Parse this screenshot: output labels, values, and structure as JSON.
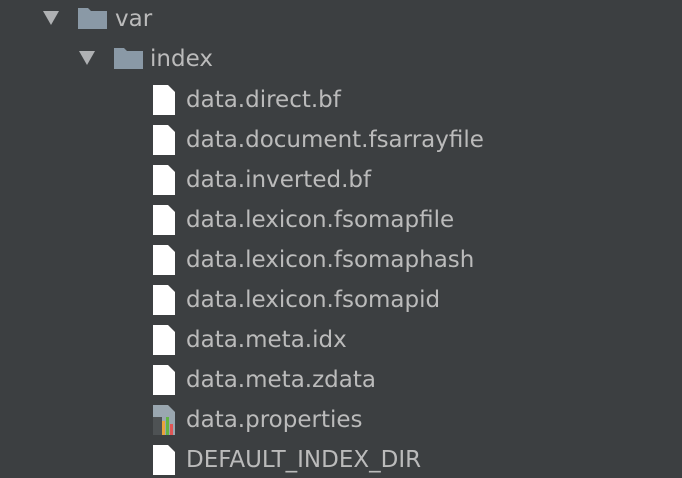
{
  "tree": {
    "root_folder": {
      "name": "var",
      "expanded": true,
      "icon": "folder-icon"
    },
    "child_folder": {
      "name": "index",
      "expanded": true,
      "icon": "folder-icon"
    },
    "files": [
      {
        "name": "data.direct.bf",
        "icon": "file-icon"
      },
      {
        "name": "data.document.fsarrayfile",
        "icon": "file-icon"
      },
      {
        "name": "data.inverted.bf",
        "icon": "file-icon"
      },
      {
        "name": "data.lexicon.fsomapfile",
        "icon": "file-icon"
      },
      {
        "name": "data.lexicon.fsomaphash",
        "icon": "file-icon"
      },
      {
        "name": "data.lexicon.fsomapid",
        "icon": "file-icon"
      },
      {
        "name": "data.meta.idx",
        "icon": "file-icon"
      },
      {
        "name": "data.meta.zdata",
        "icon": "file-icon"
      },
      {
        "name": "data.properties",
        "icon": "properties-file-icon"
      },
      {
        "name": "DEFAULT_INDEX_DIR",
        "icon": "file-icon"
      }
    ]
  },
  "colors": {
    "background": "#3c3f41",
    "text": "#bbbbbb",
    "folder": "#8a99a6",
    "file": "#ffffff",
    "arrow": "#afb1b3"
  }
}
